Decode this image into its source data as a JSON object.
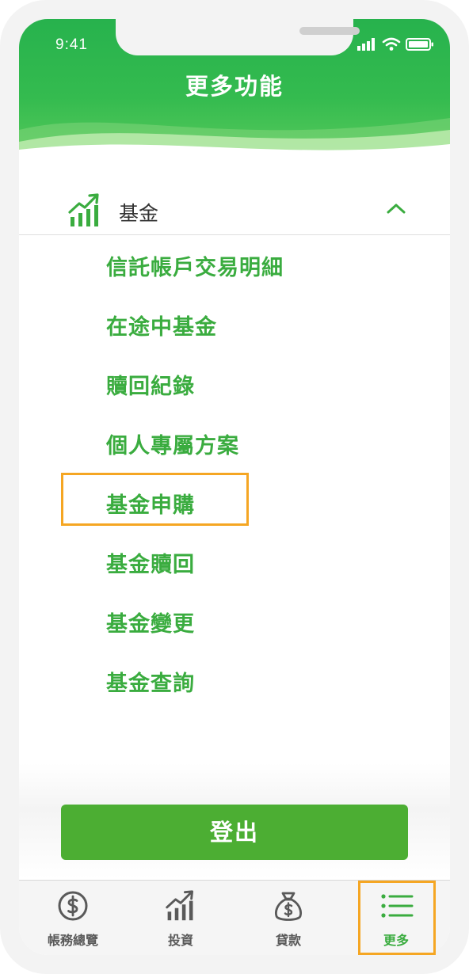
{
  "status_bar": {
    "time": "9:41"
  },
  "header": {
    "title": "更多功能"
  },
  "section": {
    "title": "基金",
    "icon": "trending-up-icon",
    "expanded": true
  },
  "menu": {
    "items": [
      {
        "label": "信託帳戶交易明細"
      },
      {
        "label": "在途中基金"
      },
      {
        "label": "贖回紀錄"
      },
      {
        "label": "個人專屬方案"
      },
      {
        "label": "基金申購"
      },
      {
        "label": "基金贖回"
      },
      {
        "label": "基金變更"
      },
      {
        "label": "基金查詢"
      }
    ],
    "highlighted_item": "基金申購"
  },
  "logout": {
    "label": "登出"
  },
  "tabbar": {
    "tabs": [
      {
        "label": "帳務總覽",
        "icon": "dollar-circle-icon",
        "active": false
      },
      {
        "label": "投資",
        "icon": "trending-up-icon",
        "active": false
      },
      {
        "label": "貸款",
        "icon": "money-bag-icon",
        "active": false
      },
      {
        "label": "更多",
        "icon": "list-icon",
        "active": true
      }
    ]
  },
  "colors": {
    "brand_green": "#3aac3f",
    "header_green": "#27b24d",
    "button_green": "#4cae33",
    "highlight_orange": "#f5a623"
  }
}
